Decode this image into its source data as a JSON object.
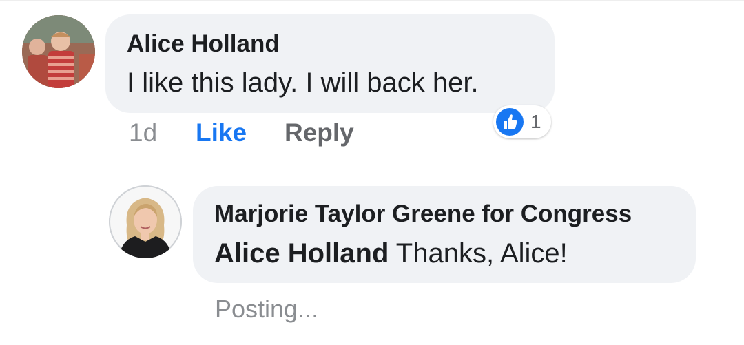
{
  "comment": {
    "author": "Alice Holland",
    "text": "I like this lady. I will back her.",
    "time": "1d",
    "like_label": "Like",
    "reply_label": "Reply",
    "reaction": {
      "icon": "like-icon",
      "count": "1",
      "color": "#1877f2"
    }
  },
  "reply": {
    "author": "Marjorie Taylor Greene for Congress",
    "mention": "Alice Holland",
    "text": " Thanks, Alice!",
    "status": "Posting..."
  },
  "colors": {
    "bubble": "#f0f2f5",
    "accent": "#1877f2",
    "meta": "#8a8d91"
  }
}
